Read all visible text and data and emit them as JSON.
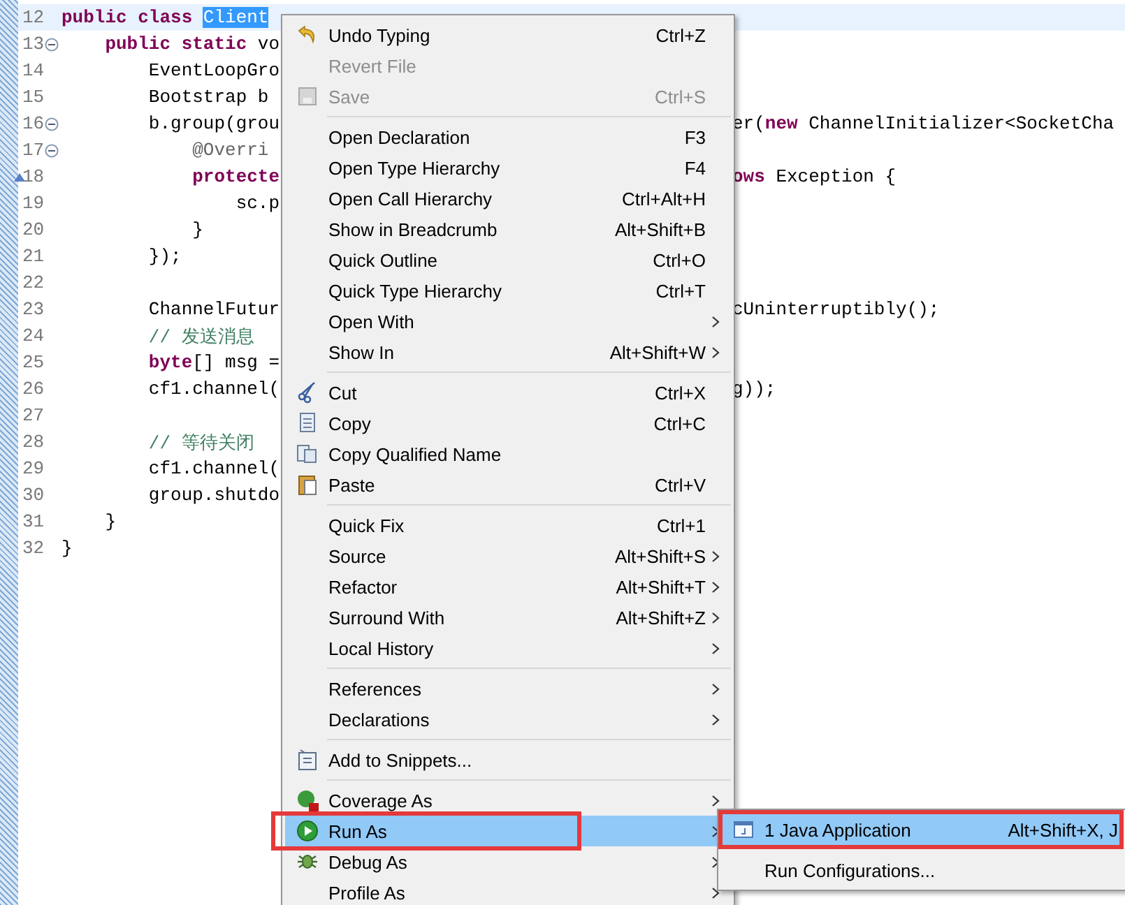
{
  "editor": {
    "lines": [
      {
        "number": "12",
        "current": true,
        "segments": [
          {
            "text": "public class ",
            "kind": "keyword"
          },
          {
            "text": "Client",
            "kind": "selection"
          }
        ]
      },
      {
        "number": "13",
        "fold": true,
        "segments": [
          {
            "text": "    public static",
            "kind": "keyword"
          },
          {
            "text": " vo"
          }
        ]
      },
      {
        "number": "14",
        "segments": [
          {
            "text": "        EventLoopGro"
          }
        ]
      },
      {
        "number": "15",
        "segments": [
          {
            "text": "        Bootstrap b"
          }
        ]
      },
      {
        "number": "16",
        "fold": true,
        "segments": [
          {
            "text": "        b.group(grou"
          }
        ],
        "right": [
          {
            "text": "er("
          },
          {
            "text": "new",
            "kind": "keyword"
          },
          {
            "text": " ChannelInitializer<SocketCha"
          }
        ]
      },
      {
        "number": "17",
        "fold": true,
        "segments": [
          {
            "text": "            @Overri",
            "kind": "annotation"
          }
        ]
      },
      {
        "number": "18",
        "marker": true,
        "segments": [
          {
            "text": "            protecte",
            "kind": "keyword"
          }
        ],
        "right": [
          {
            "text": "ows",
            "kind": "keyword"
          },
          {
            "text": " Exception {"
          }
        ]
      },
      {
        "number": "19",
        "segments": [
          {
            "text": "                sc.p"
          }
        ]
      },
      {
        "number": "20",
        "segments": [
          {
            "text": "            }"
          }
        ]
      },
      {
        "number": "21",
        "segments": [
          {
            "text": "        });"
          }
        ]
      },
      {
        "number": "22"
      },
      {
        "number": "23",
        "segments": [
          {
            "text": "        ChannelFutur"
          }
        ],
        "right": [
          {
            "text": "cUninterruptibly();"
          }
        ]
      },
      {
        "number": "24",
        "segments": [
          {
            "text": "        // 发送消息",
            "kind": "comment"
          }
        ]
      },
      {
        "number": "25",
        "segments": [
          {
            "text": "        byte",
            "kind": "keyword"
          },
          {
            "text": "[] msg ="
          }
        ]
      },
      {
        "number": "26",
        "segments": [
          {
            "text": "        cf1.channel("
          }
        ],
        "right": [
          {
            "text": "g));"
          }
        ]
      },
      {
        "number": "27"
      },
      {
        "number": "28",
        "segments": [
          {
            "text": "        // 等待关闭",
            "kind": "comment"
          }
        ]
      },
      {
        "number": "29",
        "segments": [
          {
            "text": "        cf1.channel("
          }
        ]
      },
      {
        "number": "30",
        "segments": [
          {
            "text": "        group.shutdo"
          }
        ]
      },
      {
        "number": "31",
        "segments": [
          {
            "text": "    }"
          }
        ]
      },
      {
        "number": "32",
        "segments": [
          {
            "text": "}"
          }
        ]
      }
    ]
  },
  "context_menu": {
    "items": [
      {
        "kind": "item",
        "label": "Undo Typing",
        "shortcut": "Ctrl+Z",
        "disabled": false,
        "selected": false,
        "submenu": false
      },
      {
        "kind": "item",
        "label": "Revert File",
        "disabled": true,
        "selected": false,
        "submenu": false
      },
      {
        "kind": "item",
        "label": "Save",
        "shortcut": "Ctrl+S",
        "disabled": true,
        "selected": false,
        "submenu": false
      },
      {
        "kind": "separator"
      },
      {
        "kind": "item",
        "label": "Open Declaration",
        "shortcut": "F3",
        "disabled": false,
        "selected": false,
        "submenu": false
      },
      {
        "kind": "item",
        "label": "Open Type Hierarchy",
        "shortcut": "F4",
        "disabled": false,
        "selected": false,
        "submenu": false
      },
      {
        "kind": "item",
        "label": "Open Call Hierarchy",
        "shortcut": "Ctrl+Alt+H",
        "disabled": false,
        "selected": false,
        "submenu": false
      },
      {
        "kind": "item",
        "label": "Show in Breadcrumb",
        "shortcut": "Alt+Shift+B",
        "disabled": false,
        "selected": false,
        "submenu": false
      },
      {
        "kind": "item",
        "label": "Quick Outline",
        "shortcut": "Ctrl+O",
        "disabled": false,
        "selected": false,
        "submenu": false
      },
      {
        "kind": "item",
        "label": "Quick Type Hierarchy",
        "shortcut": "Ctrl+T",
        "disabled": false,
        "selected": false,
        "submenu": false
      },
      {
        "kind": "item",
        "label": "Open With",
        "disabled": false,
        "selected": false,
        "submenu": true
      },
      {
        "kind": "item",
        "label": "Show In",
        "shortcut": "Alt+Shift+W",
        "disabled": false,
        "selected": false,
        "submenu": true
      },
      {
        "kind": "separator"
      },
      {
        "kind": "item",
        "label": "Cut",
        "shortcut": "Ctrl+X",
        "disabled": false,
        "selected": false,
        "submenu": false
      },
      {
        "kind": "item",
        "label": "Copy",
        "shortcut": "Ctrl+C",
        "disabled": false,
        "selected": false,
        "submenu": false
      },
      {
        "kind": "item",
        "label": "Copy Qualified Name",
        "disabled": false,
        "selected": false,
        "submenu": false
      },
      {
        "kind": "item",
        "label": "Paste",
        "shortcut": "Ctrl+V",
        "disabled": false,
        "selected": false,
        "submenu": false
      },
      {
        "kind": "separator"
      },
      {
        "kind": "item",
        "label": "Quick Fix",
        "shortcut": "Ctrl+1",
        "disabled": false,
        "selected": false,
        "submenu": false
      },
      {
        "kind": "item",
        "label": "Source",
        "shortcut": "Alt+Shift+S",
        "disabled": false,
        "selected": false,
        "submenu": true
      },
      {
        "kind": "item",
        "label": "Refactor",
        "shortcut": "Alt+Shift+T",
        "disabled": false,
        "selected": false,
        "submenu": true
      },
      {
        "kind": "item",
        "label": "Surround With",
        "shortcut": "Alt+Shift+Z",
        "disabled": false,
        "selected": false,
        "submenu": true
      },
      {
        "kind": "item",
        "label": "Local History",
        "disabled": false,
        "selected": false,
        "submenu": true
      },
      {
        "kind": "separator"
      },
      {
        "kind": "item",
        "label": "References",
        "disabled": false,
        "selected": false,
        "submenu": true
      },
      {
        "kind": "item",
        "label": "Declarations",
        "disabled": false,
        "selected": false,
        "submenu": true
      },
      {
        "kind": "separator"
      },
      {
        "kind": "item",
        "label": "Add to Snippets...",
        "disabled": false,
        "selected": false,
        "submenu": false
      },
      {
        "kind": "separator"
      },
      {
        "kind": "item",
        "label": "Coverage As",
        "disabled": false,
        "selected": false,
        "submenu": true
      },
      {
        "kind": "item",
        "label": "Run As",
        "disabled": false,
        "selected": true,
        "outlined": true,
        "submenu": true
      },
      {
        "kind": "item",
        "label": "Debug As",
        "disabled": false,
        "selected": false,
        "submenu": true
      },
      {
        "kind": "item",
        "label": "Profile As",
        "disabled": false,
        "selected": false,
        "submenu": true
      }
    ]
  },
  "submenu": {
    "items": [
      {
        "kind": "item",
        "label": "1 Java Application",
        "shortcut": "Alt+Shift+X, J",
        "selected": true,
        "outlined": true
      },
      {
        "kind": "separator"
      },
      {
        "kind": "item",
        "label": "Run Configurations...",
        "selected": false,
        "outlined": false
      }
    ]
  }
}
